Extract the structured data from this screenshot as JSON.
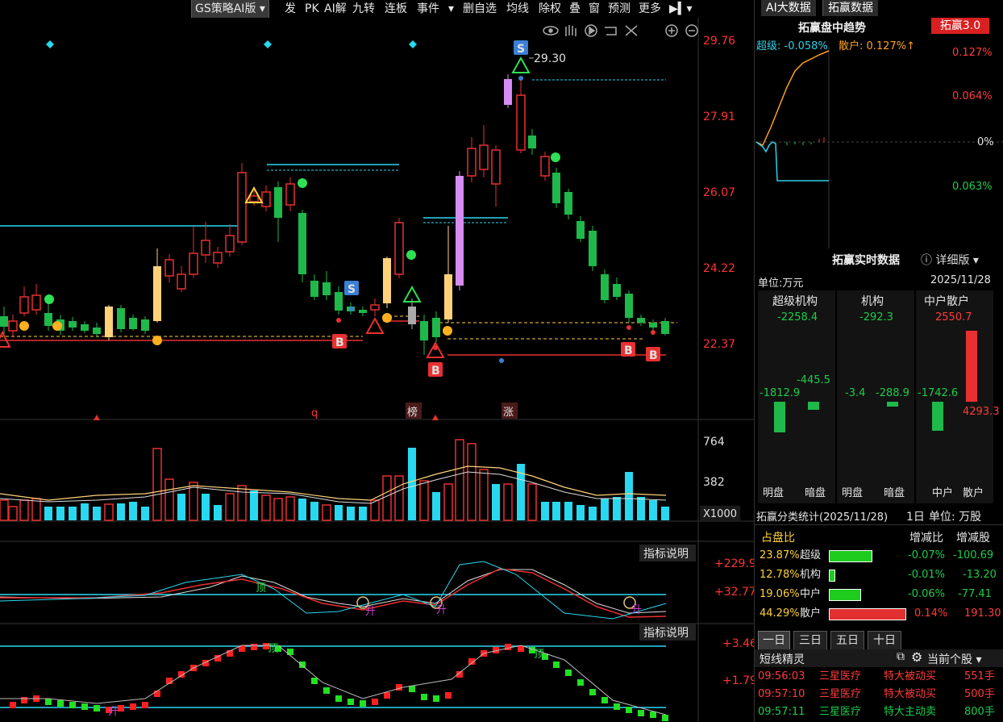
{
  "toolbar": {
    "strategy": "GS策略AI版",
    "items": [
      "发",
      "PK",
      "AI解",
      "九转",
      "连板",
      "事件",
      "删自选",
      "均线",
      "除权",
      "叠",
      "窗",
      "预测",
      "更多"
    ]
  },
  "main_chart": {
    "price_axis": [
      "29.76",
      "27.91",
      "26.07",
      "24.22",
      "22.37"
    ],
    "high_label": "29.30",
    "markers": {
      "q": "q",
      "bang": "榜",
      "zhang": "涨"
    },
    "volume_axis": [
      "764",
      "382"
    ],
    "volume_unit": "X1000",
    "indicator_btn_1": "指标说明",
    "indicator_btn_2": "指标说明",
    "ind1_axis": [
      "+229.9",
      "+32.77"
    ],
    "ind2_axis": [
      "+3.46",
      "+1.79"
    ],
    "label_ding": "顶",
    "label_sheng": "升",
    "s_label": "S",
    "b_label": "B"
  },
  "right": {
    "tabs": [
      "AI大数据",
      "拓赢数据"
    ],
    "trend_title": "拓赢盘中趋势",
    "badge": "拓赢3.0",
    "super_label": "超级: -0.058%",
    "retail_label": "散户: 0.127%↑",
    "trend_axis": [
      "0.127%",
      "0.064%",
      "0%",
      "0.063%"
    ],
    "realtime_title": "拓赢实时数据",
    "detail": "详细版",
    "unit": "单位:万元",
    "date": "2025/11/28",
    "groups": [
      {
        "title": "超级机构",
        "top": "-2258.4",
        "left": "-1812.9",
        "right": "-445.5",
        "a": "明盘",
        "b": "暗盘"
      },
      {
        "title": "机构",
        "top": "-292.3",
        "left": "-3.4",
        "right": "-288.9",
        "a": "明盘",
        "b": "暗盘"
      },
      {
        "title": "中户散户",
        "top": "2550.7",
        "left": "-1742.6",
        "right": "4293.3",
        "a": "中户",
        "b": "散户"
      }
    ],
    "stat_title": "拓赢分类统计(2025/11/28)",
    "stat_day": "1日",
    "stat_unit": "单位: 万股",
    "stat_headers": [
      "占盘比",
      "增减比",
      "增减股"
    ],
    "stat_rows": [
      {
        "pct": "23.87%",
        "name": "超级",
        "chg": "-0.07%",
        "shares": "-100.69",
        "color": "#1ecc1e"
      },
      {
        "pct": "12.78%",
        "name": "机构",
        "chg": "-0.01%",
        "shares": "-13.20",
        "color": "#1ecc1e"
      },
      {
        "pct": "19.06%",
        "name": "中户",
        "chg": "-0.06%",
        "shares": "-77.41",
        "color": "#1ecc1e"
      },
      {
        "pct": "44.29%",
        "name": "散户",
        "chg": "0.14%",
        "shares": "191.30",
        "color": "#e23030"
      }
    ],
    "period_tabs": [
      "一日",
      "三日",
      "五日",
      "十日"
    ],
    "spirit_title": "短线精灵",
    "current_stock": "当前个股",
    "spirit_rows": [
      {
        "time": "09:56:03",
        "name": "三星医疗",
        "event": "特大被动买",
        "vol": "551手",
        "color": "#ff3b3b"
      },
      {
        "time": "09:57:10",
        "name": "三星医疗",
        "event": "特大被动买",
        "vol": "500手",
        "color": "#ff3b3b"
      },
      {
        "time": "09:57:11",
        "name": "三星医疗",
        "event": "特大主动卖",
        "vol": "800手",
        "color": "#1ecc4a"
      }
    ]
  },
  "colors": {
    "up": "#e83030",
    "down": "#1fb84a",
    "cyan": "#28d8f0",
    "yellow": "#ffd27a",
    "purple": "#d68cf0"
  }
}
